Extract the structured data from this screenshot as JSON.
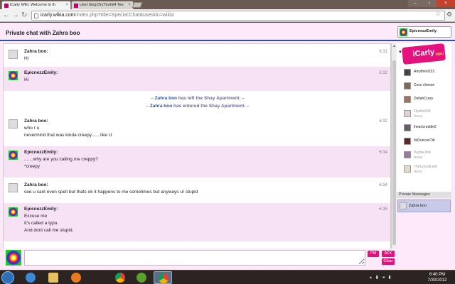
{
  "browser": {
    "tabs": [
      {
        "title": "iCarly Wiki: Welcome to th",
        "active": true
      },
      {
        "title": "User blog:DryYoshi/4 Tee",
        "active": false
      }
    ],
    "url_host": "icarly.wikia.com",
    "url_path": "/index.php?title=Special:Chat&useskin=wikia"
  },
  "chat": {
    "title": "Private chat with Zahra boo",
    "me": "EpicnezzEmily",
    "messages": [
      {
        "type": "msg",
        "name": "Zahra boo:",
        "time": "6:31",
        "lines": [
          "Hi"
        ]
      },
      {
        "type": "msg",
        "name": "EpicnezzEmily:",
        "time": "6:32",
        "lines": [
          "Hi"
        ]
      },
      {
        "type": "sys",
        "user": "Zahra boo",
        "text": "has left the Shay Apartment."
      },
      {
        "type": "sys",
        "user": "Zahra boo",
        "text": "has entered the Shay Apartment."
      },
      {
        "type": "msg",
        "name": "Zahra boo:",
        "time": "6:32",
        "lines": [
          "who r u",
          "nevermind that was kinda creepy...... like U"
        ]
      },
      {
        "type": "msg",
        "name": "EpicnezzEmily:",
        "time": "6:34",
        "lines": [
          ".......why are you calling me creppy?",
          "*creepy"
        ]
      },
      {
        "type": "msg",
        "name": "Zahra boo:",
        "time": "6:34",
        "lines": [
          "see u cant even spell but thats ok it happens to me sometimes but anyways ur stupid"
        ]
      },
      {
        "type": "msg",
        "name": "EpicnezzEmily:",
        "time": "6:35",
        "lines": [
          "Excuse me",
          "It's called a typo.",
          "And dont call me stupid."
        ]
      }
    ],
    "buttons": {
      "pm": "PM",
      "afk": "AFK",
      "clear": "Clear"
    }
  },
  "sidebar": {
    "logo_text": "iCarly",
    "logo_sub": "WIKI",
    "users": [
      {
        "name": "Amythest222",
        "status": ""
      },
      {
        "name": "Coco cheese",
        "status": ""
      },
      {
        "name": "DellahCrazy",
        "status": ""
      },
      {
        "name": "Flychick98",
        "status": "Away"
      },
      {
        "name": "iheartcreddie2",
        "status": ""
      },
      {
        "name": "ItsDuncanTdi",
        "status": ""
      },
      {
        "name": "PurpleJerk",
        "status": "Away"
      },
      {
        "name": "TheLyricalLeaf",
        "status": "Away"
      }
    ],
    "private_header": "Private Messages",
    "private_users": [
      "Zahra boo"
    ]
  },
  "taskbar": {
    "time": "6:40 PM",
    "date": "7/30/2012"
  },
  "colors": {
    "accent_pink": "#e5127d",
    "header_blue": "#2b51a8",
    "page_bg": "#fde9fa"
  }
}
